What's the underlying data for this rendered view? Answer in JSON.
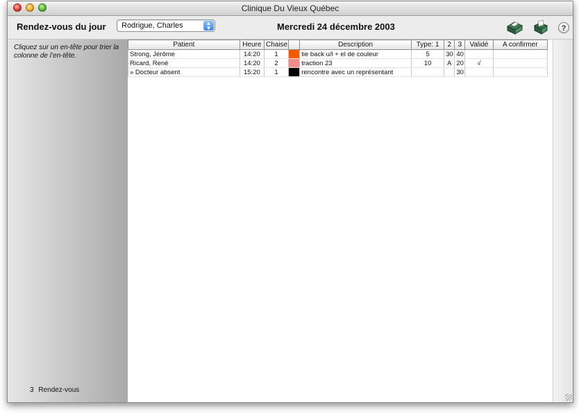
{
  "window": {
    "title": "Clinique Du Vieux Québec"
  },
  "toolbar": {
    "label": "Rendez-vous du jour",
    "doctor_select": {
      "value": "Rodrigue, Charles"
    },
    "date": "Mercredi 24 décembre 2003",
    "help_label": "?"
  },
  "sidebar": {
    "hint": "Cliquez sur un en-tête pour trier la colonne de l’en-tête.",
    "count_number": "3",
    "count_label": "Rendez-vous"
  },
  "table": {
    "headers": [
      "Patient",
      "Heure",
      "Chaise",
      "",
      "Description",
      "Type: 1",
      "2",
      "3",
      "Validé",
      "A confirmer"
    ],
    "rows": [
      {
        "patient": "Strong, Jérôme",
        "heure": "14:20",
        "chaise": "1",
        "color": "#f25a00",
        "description": "tie back u/l + el de couleur",
        "type1": "5",
        "type2": "30",
        "type3": "40",
        "valide": "",
        "confirmer": ""
      },
      {
        "patient": "Ricard, René",
        "heure": "14:20",
        "chaise": "2",
        "color": "#f28c8c",
        "description": "traction 23",
        "type1": "10",
        "type2": "A",
        "type3": "20",
        "valide": "√",
        "confirmer": ""
      },
      {
        "patient": "» Docteur absent",
        "heure": "15:20",
        "chaise": "1",
        "color": "#000000",
        "description": "rencontre avec un représentant",
        "type1": "",
        "type2": "",
        "type3": "30",
        "valide": "",
        "confirmer": ""
      }
    ]
  },
  "icons": {
    "print": "printer-icon",
    "fax": "fax-icon"
  }
}
